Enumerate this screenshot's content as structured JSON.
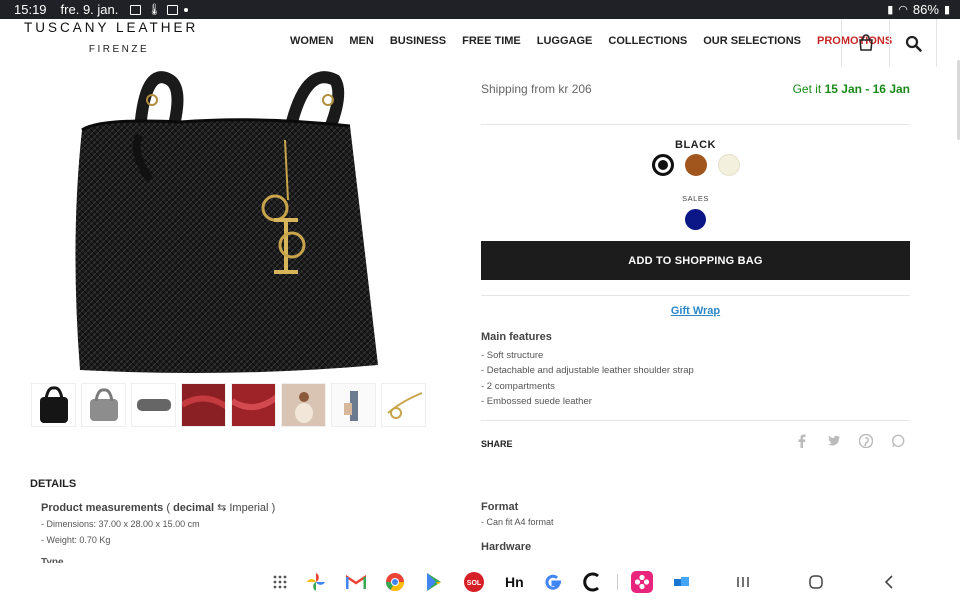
{
  "status_bar": {
    "time": "15:19",
    "date": "fre. 9. jan.",
    "battery": "86%"
  },
  "header": {
    "brand": "TUSCANY LEATHER",
    "brand_sub": "FIRENZE",
    "nav": [
      "WOMEN",
      "MEN",
      "BUSINESS",
      "FREE TIME",
      "LUGGAGE",
      "COLLECTIONS",
      "OUR SELECTIONS",
      "PROMOTIONS"
    ],
    "icons": [
      "shopping-bag-icon",
      "search-icon"
    ]
  },
  "gallery": {
    "thumbnail_count": 8
  },
  "product": {
    "shipping_from": "Shipping from kr 206",
    "get_it_prefix": "Get it",
    "get_it_range": "15 Jan - 16 Jan",
    "selected_color": "BLACK",
    "colors": [
      "#111111",
      "#a0561c",
      "#f3f0de"
    ],
    "sales_label": "SALES",
    "sales_color": "#0b1687",
    "add_button": "ADD TO SHOPPING BAG",
    "gift_wrap": "Gift Wrap",
    "features_title": "Main features",
    "features": [
      "- Soft structure",
      "- Detachable and adjustable leather shoulder strap",
      "- 2 compartments",
      "- Embossed suede leather"
    ],
    "share_label": "SHARE",
    "share_icons": [
      "facebook-icon",
      "twitter-icon",
      "pinterest-icon",
      "whatsapp-icon"
    ]
  },
  "details": {
    "title": "DETAILS",
    "pm_label": "Product measurements",
    "pm_decimal": "decimal",
    "pm_imperial": "Imperial",
    "measurements": [
      "- Dimensions: 37.00 x 28.00 x 15.00 cm",
      "- Weight: 0.70 Kg"
    ],
    "type_label": "Type",
    "format_title": "Format",
    "format_items": [
      "- Can fit A4 format"
    ],
    "hardware_title": "Hardware"
  },
  "taskbar": {
    "apps": [
      "app-drawer-icon",
      "photos-icon",
      "gmail-icon",
      "chrome-icon",
      "play-store-icon",
      "sol-icon",
      "hn-icon",
      "google-icon",
      "c-app-icon",
      "flower-app-icon",
      "app-blue-icon"
    ],
    "nav": [
      "recent-apps-icon",
      "home-icon",
      "back-icon"
    ]
  }
}
